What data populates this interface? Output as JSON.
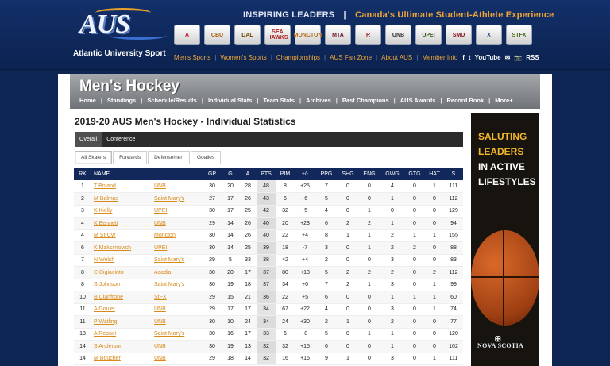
{
  "header": {
    "logo_text": "AUS",
    "logo_subtitle": "Atlantic University Sport",
    "tagline_a": "INSPIRING LEADERS",
    "tagline_sep": "|",
    "tagline_b": "Canada's Ultimate Student-Athlete Experience",
    "teams": [
      {
        "abbr": "A",
        "color": "#c8102e"
      },
      {
        "abbr": "CBU",
        "color": "#a35a00"
      },
      {
        "abbr": "DAL",
        "color": "#6b4a00"
      },
      {
        "abbr": "SEA HAWKS",
        "color": "#b0201f"
      },
      {
        "abbr": "MONCTON",
        "color": "#b06b10"
      },
      {
        "abbr": "MTA",
        "color": "#6b0e1e"
      },
      {
        "abbr": "R",
        "color": "#9e1b1b"
      },
      {
        "abbr": "UNB",
        "color": "#2e2e2e"
      },
      {
        "abbr": "UPEI",
        "color": "#3b5e1c"
      },
      {
        "abbr": "SMU",
        "color": "#8a0c1c"
      },
      {
        "abbr": "X",
        "color": "#1e3f8a"
      },
      {
        "abbr": "STFX",
        "color": "#4d6a1a"
      }
    ],
    "nav": [
      "Men's Sports",
      "Women's Sports",
      "Championships",
      "AUS Fan Zone",
      "About AUS",
      "Member Info"
    ],
    "social": [
      "f",
      "t",
      "YouTube",
      "✉",
      "📷",
      "RSS"
    ]
  },
  "banner": {
    "title": "Men's Hockey",
    "nav": [
      "Home",
      "Standings",
      "Schedule/Results",
      "Individual Stats",
      "Team Stats",
      "Archives",
      "Past Champions",
      "AUS Awards",
      "Record Book",
      "More+"
    ]
  },
  "page_title": "2019-20 AUS Men's Hockey - Individual Statistics",
  "tabs": [
    "Overall",
    "Conference"
  ],
  "subtabs": [
    "All Skaters",
    "Forwards",
    "Defensemen",
    "Goalies"
  ],
  "table": {
    "columns": [
      "RK",
      "NAME",
      "",
      "GP",
      "G",
      "A",
      "PTS",
      "PIM",
      "+/-",
      "PPG",
      "SHG",
      "ENG",
      "GWG",
      "GTG",
      "HAT",
      "S"
    ],
    "rows": [
      [
        "1",
        "T Boland",
        "UNB",
        "30",
        "20",
        "28",
        "48",
        "8",
        "+25",
        "7",
        "0",
        "0",
        "4",
        "0",
        "1",
        "111"
      ],
      [
        "2",
        "M Balmas",
        "Saint Mary's",
        "27",
        "17",
        "26",
        "43",
        "6",
        "-6",
        "5",
        "0",
        "0",
        "1",
        "0",
        "0",
        "112"
      ],
      [
        "3",
        "K Kielly",
        "UPEI",
        "30",
        "17",
        "25",
        "42",
        "32",
        "-5",
        "4",
        "0",
        "1",
        "0",
        "0",
        "0",
        "129"
      ],
      [
        "4",
        "K Bennett",
        "UNB",
        "29",
        "14",
        "26",
        "40",
        "20",
        "+23",
        "6",
        "2",
        "2",
        "1",
        "0",
        "0",
        "94"
      ],
      [
        "4",
        "M St-Cyr",
        "Moncton",
        "30",
        "14",
        "26",
        "40",
        "22",
        "+4",
        "8",
        "1",
        "1",
        "2",
        "1",
        "1",
        "155"
      ],
      [
        "6",
        "K Maksimovich",
        "UPEI",
        "30",
        "14",
        "25",
        "39",
        "18",
        "-7",
        "3",
        "0",
        "1",
        "2",
        "2",
        "0",
        "88"
      ],
      [
        "7",
        "N Welsh",
        "Saint Mary's",
        "29",
        "5",
        "33",
        "38",
        "42",
        "+4",
        "2",
        "0",
        "0",
        "3",
        "0",
        "0",
        "83"
      ],
      [
        "8",
        "C Digiacinto",
        "Acadia",
        "30",
        "20",
        "17",
        "37",
        "80",
        "+13",
        "5",
        "2",
        "2",
        "2",
        "0",
        "2",
        "112"
      ],
      [
        "8",
        "S Johnson",
        "Saint Mary's",
        "30",
        "19",
        "18",
        "37",
        "34",
        "+0",
        "7",
        "2",
        "1",
        "3",
        "0",
        "1",
        "99"
      ],
      [
        "10",
        "B Cianfrone",
        "StFX",
        "29",
        "15",
        "21",
        "36",
        "22",
        "+5",
        "6",
        "0",
        "0",
        "1",
        "1",
        "1",
        "60"
      ],
      [
        "11",
        "A Goulet",
        "UNB",
        "29",
        "17",
        "17",
        "34",
        "67",
        "+22",
        "4",
        "0",
        "0",
        "3",
        "0",
        "1",
        "74"
      ],
      [
        "11",
        "P Watling",
        "UNB",
        "30",
        "10",
        "24",
        "34",
        "24",
        "+30",
        "2",
        "1",
        "0",
        "2",
        "0",
        "0",
        "77"
      ],
      [
        "13",
        "A Repaci",
        "Saint Mary's",
        "30",
        "16",
        "17",
        "33",
        "6",
        "-8",
        "5",
        "0",
        "1",
        "1",
        "0",
        "0",
        "120"
      ],
      [
        "14",
        "S Anderson",
        "UNB",
        "30",
        "19",
        "13",
        "32",
        "32",
        "+15",
        "6",
        "0",
        "0",
        "1",
        "0",
        "0",
        "102"
      ],
      [
        "14",
        "M Boucher",
        "UNB",
        "29",
        "18",
        "14",
        "32",
        "16",
        "+15",
        "9",
        "1",
        "0",
        "3",
        "0",
        "1",
        "111"
      ]
    ]
  },
  "ad": {
    "line1": "SALUTING",
    "line2": "LEADERS",
    "line3": "IN ACTIVE",
    "line4": "LIFESTYLES",
    "sponsor": "NOVA SCOTIA"
  }
}
